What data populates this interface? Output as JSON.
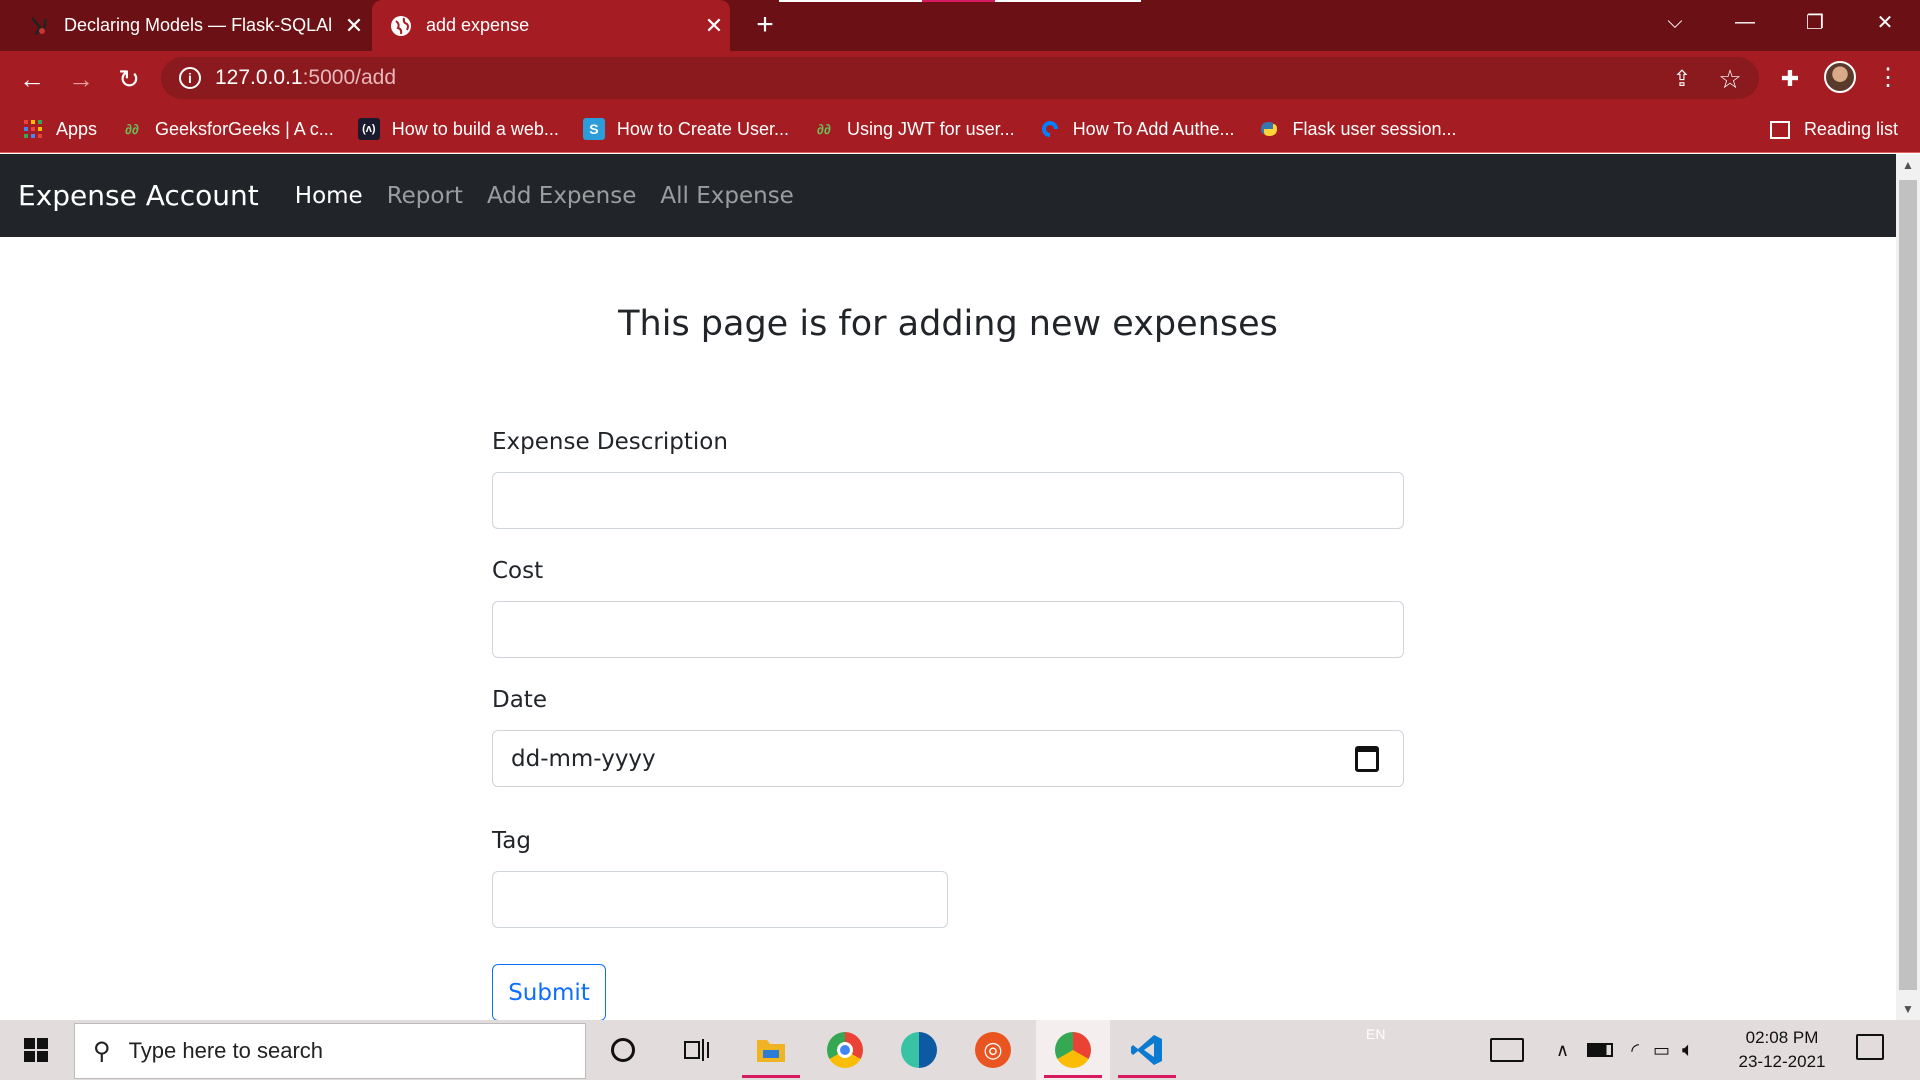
{
  "browser": {
    "tabs": [
      {
        "title": "Declaring Models — Flask-SQLAl",
        "close": "✕",
        "active": false
      },
      {
        "title": "add expense",
        "close": "✕",
        "active": true
      }
    ],
    "new_tab": "+",
    "window_controls": {
      "dropdown": "⌵",
      "minimize": "—",
      "restore": "❐",
      "close": "✕"
    },
    "nav": {
      "back": "←",
      "forward": "→",
      "reload": "↻"
    },
    "address": {
      "info_icon": "i",
      "host": "127.0.0.1",
      "path": ":5000/add"
    },
    "toolbar_icons": {
      "share": "⇪",
      "star": "☆",
      "extensions": "✚",
      "menu": "⋮"
    },
    "bookmarks": [
      {
        "label": "Apps",
        "icon": "apps-grid-icon"
      },
      {
        "label": "GeeksforGeeks | A c...",
        "icon": "gfg-icon"
      },
      {
        "label": "How to build a web...",
        "icon": "devdojo-icon"
      },
      {
        "label": "How to Create User...",
        "icon": "s-icon"
      },
      {
        "label": "Using JWT for user...",
        "icon": "gfg-icon"
      },
      {
        "label": "How To Add Authe...",
        "icon": "digitalocean-icon"
      },
      {
        "label": "Flask user session...",
        "icon": "python-icon"
      }
    ],
    "reading_list": "Reading list"
  },
  "navbar": {
    "brand": "Expense Account",
    "links": [
      {
        "label": "Home",
        "active": true
      },
      {
        "label": "Report",
        "active": false
      },
      {
        "label": "Add Expense",
        "active": false
      },
      {
        "label": "All Expense",
        "active": false
      }
    ]
  },
  "page": {
    "heading": "This page is for adding new expenses",
    "form": {
      "description_label": "Expense Description",
      "description_value": "",
      "cost_label": "Cost",
      "cost_value": "",
      "date_label": "Date",
      "date_placeholder": "dd-mm-yyyy",
      "tag_label": "Tag",
      "tag_value": "",
      "submit_label": "Submit"
    }
  },
  "taskbar": {
    "search_placeholder": "Type here to search",
    "language": "EN",
    "time": "02:08 PM",
    "date": "23-12-2021"
  },
  "colors": {
    "browser_frame": "#a51d22",
    "tabstrip": "#6b1014",
    "navbar": "#212529",
    "primary": "#0d6efd"
  }
}
